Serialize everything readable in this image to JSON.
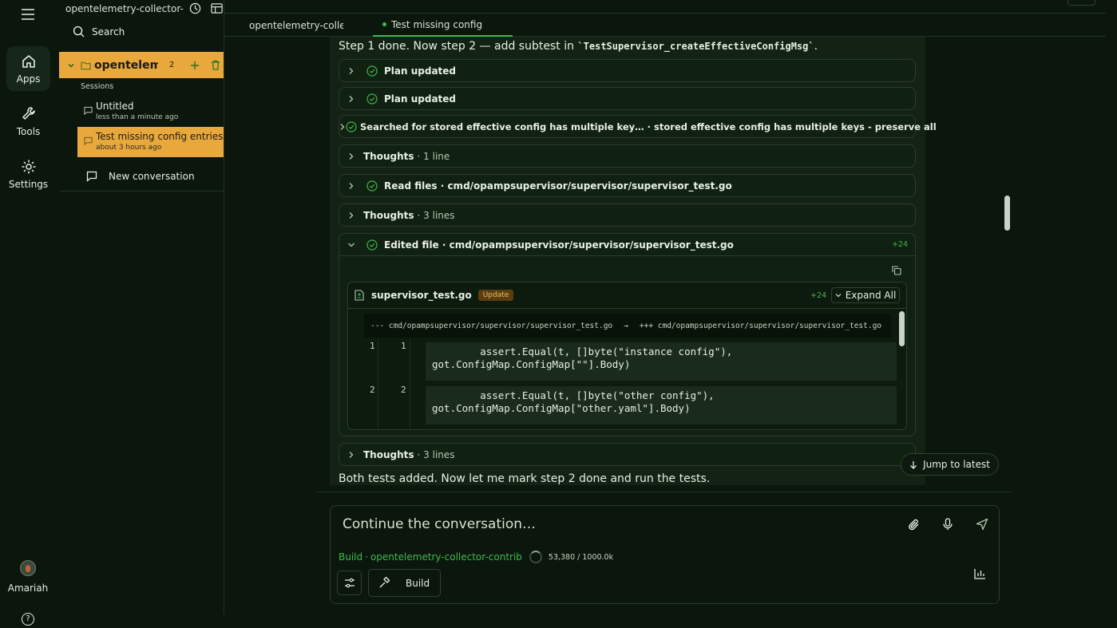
{
  "rail": {
    "apps_label": "Apps",
    "tools_label": "Tools",
    "settings_label": "Settings",
    "user_name": "Amariah"
  },
  "panel": {
    "window_title": "opentelemetry-collector-contrib",
    "search_label": "Search",
    "project_name": "opentelemetry-collector-contrib",
    "project_count": "2",
    "sessions_heading": "Sessions",
    "sessions": [
      {
        "title": "Untitled",
        "time": "less than a minute ago"
      },
      {
        "title": "Test missing config entries",
        "time": "about 3 hours ago"
      }
    ],
    "new_conversation": "New conversation"
  },
  "tabs": [
    {
      "label": "opentelemetry-collector-contrib"
    },
    {
      "label": "Test missing config entries"
    }
  ],
  "chat": {
    "step_intro": "Step 1 done. Now step 2 — add subtest in",
    "step_code": "`TestSupervisor_createEffectiveConfigMsg`",
    "step_end": ".",
    "rows": [
      {
        "bold": "Plan updated",
        "rest": ""
      },
      {
        "bold": "Plan updated",
        "rest": ""
      },
      {
        "bold": "Searched for stored effective config has multiple key… · stored effective config has multiple keys - preserve all",
        "rest": ""
      },
      {
        "bold": "Thoughts",
        "rest": "· 1 line"
      },
      {
        "bold": "Read files · cmd/opampsupervisor/supervisor/supervisor_test.go",
        "rest": ""
      },
      {
        "bold": "Thoughts",
        "rest": "· 3 lines"
      }
    ],
    "edited": {
      "label": "Edited file · cmd/opampsupervisor/supervisor/supervisor_test.go",
      "delta": "+24",
      "file_name": "supervisor_test.go",
      "badge": "Update",
      "file_delta": "+24",
      "expand_all": "Expand All",
      "diff_old": "--- cmd/opampsupervisor/supervisor/supervisor_test.go",
      "diff_arrow": "→",
      "diff_new": "+++ cmd/opampsupervisor/supervisor/supervisor_test.go",
      "lines": [
        {
          "old": "1",
          "new": "1",
          "code": "        assert.Equal(t, []byte(\"instance config\"),\ngot.ConfigMap.ConfigMap[\"\"].Body)"
        },
        {
          "old": "2",
          "new": "2",
          "code": "        assert.Equal(t, []byte(\"other config\"),\ngot.ConfigMap.ConfigMap[\"other.yaml\"].Body)"
        }
      ]
    },
    "thoughts_after": {
      "bold": "Thoughts",
      "rest": "· 3 lines"
    },
    "final_message": "Both tests added. Now let me mark step 2 done and run the tests.",
    "jump_label": "Jump to latest"
  },
  "composer": {
    "placeholder": "Continue the conversation…",
    "mode": "Build",
    "project": "opentelemetry-collector-contrib",
    "tokens_used": "53,380",
    "tokens_sep": "/",
    "tokens_max": "1000.0k",
    "build_button": "Build"
  },
  "colors": {
    "accent": "#e8a83c",
    "background": "#0b160c",
    "success": "#3fb950"
  }
}
